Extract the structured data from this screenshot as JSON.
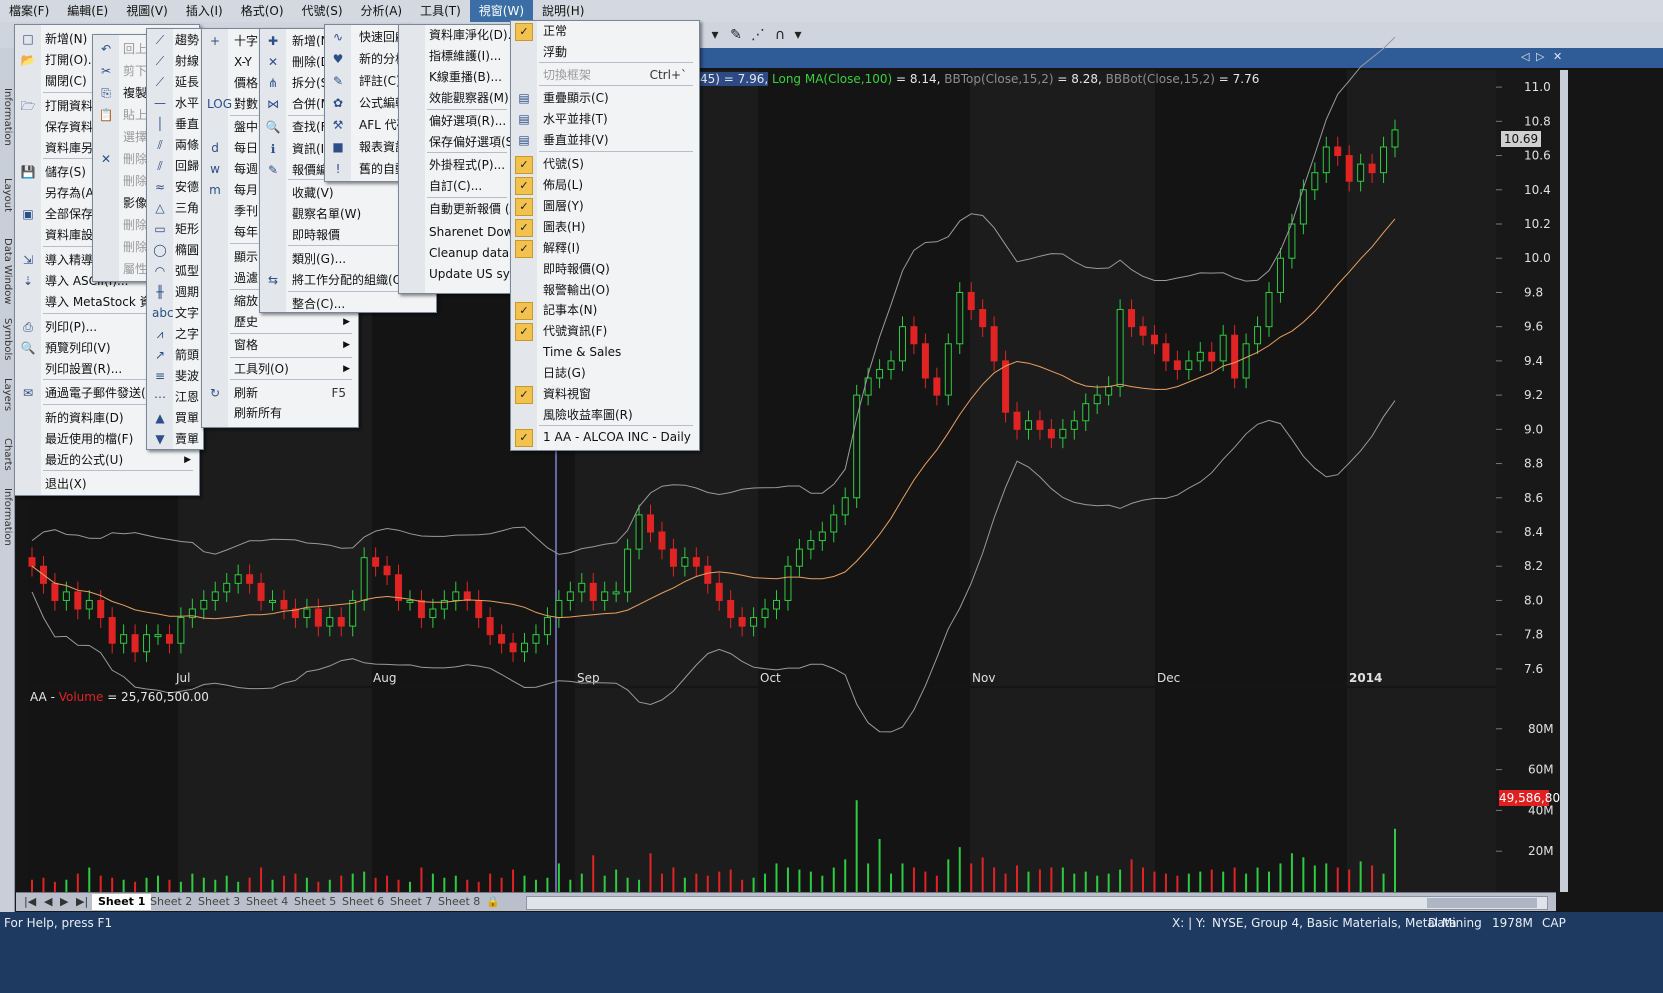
{
  "menubar": [
    "檔案(F)",
    "編輯(E)",
    "視圖(V)",
    "插入(I)",
    "格式(O)",
    "代號(S)",
    "分析(A)",
    "工具(T)",
    "視窗(W)",
    "說明(H)"
  ],
  "left_tabs": [
    "Information",
    "Layout",
    "Data Window",
    "Symbols",
    "Layers",
    "Charts",
    "Information"
  ],
  "file_menu": [
    {
      "label": "新增(N)",
      "icon": "new-icon"
    },
    {
      "label": "打開(O)...",
      "icon": "open-icon"
    },
    {
      "label": "關閉(C)",
      "icon": ""
    },
    {
      "label": "打開資料庫...",
      "icon": "open-db-icon"
    },
    {
      "label": "保存資料庫",
      "icon": ""
    },
    {
      "label": "資料庫另存...",
      "icon": ""
    },
    {
      "label": "儲存(S)",
      "icon": "save-icon"
    },
    {
      "label": "另存為(A)...",
      "icon": ""
    },
    {
      "label": "全部保存",
      "icon": "save-all-icon"
    },
    {
      "label": "資料庫設定...",
      "icon": ""
    },
    {
      "label": "導入精導...",
      "icon": "import-wizard-icon"
    },
    {
      "label": "導入 ASCII(I)...",
      "icon": "import-icon"
    },
    {
      "label": "導入 MetaStock 資料...",
      "icon": ""
    },
    {
      "label": "列印(P)...",
      "icon": "print-icon"
    },
    {
      "label": "預覽列印(V)",
      "icon": "preview-icon"
    },
    {
      "label": "列印設置(R)...",
      "icon": ""
    },
    {
      "label": "通過電子郵件發送(E)",
      "icon": "mail-icon"
    },
    {
      "label": "新的資料庫(D)",
      "icon": ""
    },
    {
      "label": "最近使用的檔(F)",
      "icon": ""
    },
    {
      "label": "最近的公式(U)",
      "icon": ""
    },
    {
      "label": "退出(X)",
      "icon": ""
    }
  ],
  "edit_menu": [
    "回上",
    "剪下",
    "複製",
    "貼上",
    "選擇",
    "刪除",
    "刪除",
    "影像",
    "刪除",
    "刪除",
    "屬性"
  ],
  "insert_menu": [
    "趨勢",
    "射線",
    "延長",
    "水平",
    "垂直",
    "兩條",
    "回歸",
    "安德",
    "三角",
    "矩形",
    "橢圓",
    "弧型",
    "週期",
    "文字",
    "之字",
    "箭頭",
    "斐波",
    "江恩",
    "買單",
    "賣單"
  ],
  "view_menu": [
    "十字",
    "X-Y",
    "價格",
    "對數",
    "盤中",
    "每日",
    "每週",
    "每月",
    "季刊",
    "每年",
    "顯示",
    "過濾",
    "縮放",
    "歷史",
    "窗格",
    "工具列(O)",
    "刷新",
    "刷新所有"
  ],
  "view_refresh_key": "F5",
  "symbol_menu": [
    "新增(N)",
    "刪除(D)",
    "拆分(S)",
    "合併(M)",
    "查找(F)",
    "資訊(I)",
    "報價編輯",
    "收藏(V)",
    "觀察名單(W)",
    "即時報價",
    "類別(G)...",
    "將工作分配的組織(O)",
    "整合(C)..."
  ],
  "analysis_menu": [
    "快速回顧",
    "新的分析",
    "評註(C)",
    "公式編輯",
    "AFL 代碼",
    "報表資訊",
    "舊的自動"
  ],
  "tools_menu": [
    "資料庫淨化(D)...",
    "指標維護(I)...",
    "K線重播(B)...",
    "效能觀察器(M)...",
    "偏好選項(R)...",
    "保存偏好選項(S)",
    "外掛程式(P)...",
    "自訂(C)...",
    "自動更新報價 (AmiQuote)",
    "Sharenet Download",
    "Cleanup database",
    "Update US symbol list"
  ],
  "window_menu": [
    {
      "label": "正常",
      "checked": true
    },
    {
      "label": "浮動",
      "checked": false
    },
    {
      "label": "切換框架",
      "checked": false,
      "shortcut": "Ctrl+`",
      "disabled": true
    },
    {
      "label": "重疊顯示(C)",
      "checked": false
    },
    {
      "label": "水平並排(T)",
      "checked": false
    },
    {
      "label": "垂直並排(V)",
      "checked": false
    },
    {
      "label": "代號(S)",
      "checked": true
    },
    {
      "label": "佈局(L)",
      "checked": true
    },
    {
      "label": "圖層(Y)",
      "checked": true
    },
    {
      "label": "圖表(H)",
      "checked": true
    },
    {
      "label": "解釋(I)",
      "checked": true
    },
    {
      "label": "即時報價(Q)",
      "checked": false
    },
    {
      "label": "報警輸出(O)",
      "checked": false
    },
    {
      "label": "記事本(N)",
      "checked": true
    },
    {
      "label": "代號資訊(F)",
      "checked": true
    },
    {
      "label": "Time & Sales",
      "checked": false
    },
    {
      "label": "日誌(G)",
      "checked": false
    },
    {
      "label": "資料視窗",
      "checked": true
    },
    {
      "label": "風險收益率圖(R)",
      "checked": false
    },
    {
      "label": "1 AA - ALCOA INC - Daily",
      "checked": true
    }
  ],
  "chart_header": {
    "shortma": "45) = 7.96,",
    "longma_label": "Long MA(Close,100)",
    "longma_value": "= 8.14,",
    "bbtop_label": "BBTop(Close,15,2)",
    "bbtop_value": "= 8.28,",
    "bbbot_label": "BBBot(Close,15,2)",
    "bbbot_value": "= 7.76"
  },
  "volume_title": {
    "prefix": "AA - ",
    "name": "Volume",
    "value": "= 25,760,500.00"
  },
  "price_tag": "10.69",
  "volume_tag": "49,586,80",
  "sheets": [
    "Sheet 1",
    "Sheet 2",
    "Sheet 3",
    "Sheet 4",
    "Sheet 5",
    "Sheet 6",
    "Sheet 7",
    "Sheet 8"
  ],
  "status": {
    "help": "For Help, press F1",
    "xy": "X: | Y:",
    "info": "NYSE, Group 4, Basic Materials, Metal Mining",
    "data": "Data",
    "mem": "1978M",
    "cap": "CAP"
  },
  "chart_data": {
    "type": "candlestick",
    "x_labels": [
      "Jul",
      "Aug",
      "Sep",
      "Oct",
      "Nov",
      "Dec",
      "2014"
    ],
    "y_ticks": [
      7.6,
      7.8,
      8.0,
      8.2,
      8.4,
      8.6,
      8.8,
      9.0,
      9.2,
      9.4,
      9.6,
      9.8,
      10.0,
      10.2,
      10.4,
      10.6,
      10.8,
      11.0
    ],
    "ylim": [
      7.5,
      11.1
    ],
    "close": [
      8.2,
      8.1,
      8.0,
      8.05,
      7.95,
      8.0,
      7.9,
      7.75,
      7.8,
      7.7,
      7.8,
      7.8,
      7.75,
      7.9,
      7.95,
      8.0,
      8.05,
      8.1,
      8.15,
      8.1,
      8.0,
      8.0,
      7.95,
      7.9,
      7.95,
      7.85,
      7.9,
      7.85,
      8.0,
      8.25,
      8.2,
      8.15,
      8.0,
      8.0,
      7.9,
      7.95,
      8.0,
      8.05,
      8.0,
      7.9,
      7.8,
      7.75,
      7.7,
      7.75,
      7.8,
      7.9,
      8.0,
      8.05,
      8.1,
      8.0,
      8.05,
      8.05,
      8.3,
      8.5,
      8.4,
      8.3,
      8.2,
      8.25,
      8.2,
      8.1,
      8.0,
      7.9,
      7.85,
      7.9,
      7.95,
      8.0,
      8.2,
      8.3,
      8.35,
      8.4,
      8.5,
      8.6,
      9.2,
      9.3,
      9.35,
      9.4,
      9.6,
      9.5,
      9.3,
      9.2,
      9.5,
      9.8,
      9.7,
      9.6,
      9.4,
      9.1,
      9.0,
      9.05,
      9.0,
      8.95,
      9.0,
      9.05,
      9.15,
      9.2,
      9.25,
      9.7,
      9.6,
      9.55,
      9.5,
      9.4,
      9.35,
      9.4,
      9.45,
      9.4,
      9.55,
      9.3,
      9.5,
      9.6,
      9.8,
      10.0,
      10.2,
      10.4,
      10.5,
      10.65,
      10.6,
      10.45,
      10.55,
      10.5,
      10.65,
      10.75
    ],
    "open": [
      8.25,
      8.2,
      8.1,
      8.0,
      8.05,
      7.95,
      8.0,
      7.9,
      7.75,
      7.8,
      7.7,
      7.8,
      7.8,
      7.75,
      7.9,
      7.95,
      8.0,
      8.05,
      8.1,
      8.15,
      8.1,
      8.0,
      8.0,
      7.95,
      7.9,
      7.95,
      7.85,
      7.9,
      7.85,
      8.0,
      8.25,
      8.2,
      8.15,
      8.0,
      8.0,
      7.9,
      7.95,
      8.0,
      8.05,
      8.0,
      7.9,
      7.8,
      7.75,
      7.7,
      7.75,
      7.8,
      7.9,
      8.0,
      8.05,
      8.1,
      8.0,
      8.05,
      8.05,
      8.3,
      8.5,
      8.4,
      8.3,
      8.2,
      8.25,
      8.2,
      8.1,
      8.0,
      7.9,
      7.85,
      7.9,
      7.95,
      8.0,
      8.2,
      8.3,
      8.35,
      8.4,
      8.5,
      8.6,
      9.2,
      9.3,
      9.35,
      9.4,
      9.6,
      9.5,
      9.3,
      9.2,
      9.5,
      9.8,
      9.7,
      9.6,
      9.4,
      9.1,
      9.0,
      9.05,
      9.0,
      8.95,
      9.0,
      9.05,
      9.15,
      9.2,
      9.25,
      9.7,
      9.6,
      9.55,
      9.5,
      9.4,
      9.35,
      9.4,
      9.45,
      9.4,
      9.55,
      9.3,
      9.5,
      9.6,
      9.8,
      10.0,
      10.2,
      10.4,
      10.5,
      10.65,
      10.6,
      10.45,
      10.55,
      10.5,
      10.65
    ],
    "volume_millions": [
      6,
      7,
      5,
      6,
      9,
      12,
      8,
      7,
      6,
      5,
      7,
      8,
      6,
      5,
      9,
      7,
      6,
      8,
      5,
      7,
      12,
      6,
      8,
      9,
      7,
      5,
      6,
      8,
      9,
      10,
      7,
      8,
      6,
      5,
      12,
      9,
      7,
      8,
      6,
      5,
      9,
      7,
      11,
      8,
      6,
      7,
      14,
      6,
      9,
      18,
      8,
      11,
      7,
      6,
      19,
      9,
      12,
      7,
      9,
      8,
      10,
      11,
      6,
      7,
      9,
      14,
      12,
      11,
      10,
      8,
      12,
      16,
      45,
      14,
      26,
      9,
      14,
      12,
      10,
      8,
      16,
      22,
      14,
      17,
      12,
      9,
      13,
      10,
      11,
      12,
      12,
      9,
      10,
      8,
      9,
      11,
      16,
      12,
      10,
      9,
      8,
      9,
      10,
      11,
      10,
      12,
      9,
      12,
      10,
      14,
      19,
      17,
      13,
      14,
      12,
      11,
      15,
      13,
      9,
      31
    ]
  }
}
